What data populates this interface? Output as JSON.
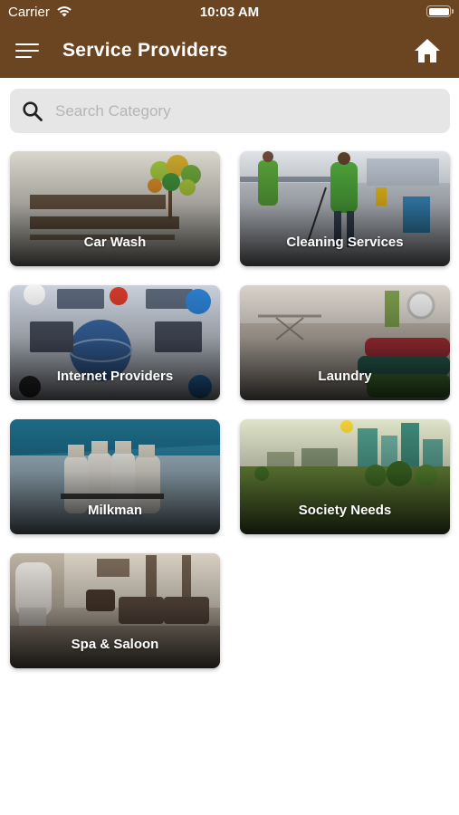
{
  "status_bar": {
    "carrier": "Carrier",
    "time": "10:03 AM"
  },
  "header": {
    "title": "Service Providers",
    "menu_icon": "hamburger-menu-icon",
    "home_icon": "home-icon"
  },
  "search": {
    "placeholder": "Search Category",
    "value": "",
    "icon": "search-icon"
  },
  "categories": [
    {
      "label": "Car Wash"
    },
    {
      "label": "Cleaning Services"
    },
    {
      "label": "Internet Providers"
    },
    {
      "label": "Laundry"
    },
    {
      "label": "Milkman"
    },
    {
      "label": "Society Needs"
    },
    {
      "label": "Spa & Saloon"
    }
  ],
  "colors": {
    "header_bg": "#6b4422",
    "search_bg": "#e6e6e6"
  }
}
